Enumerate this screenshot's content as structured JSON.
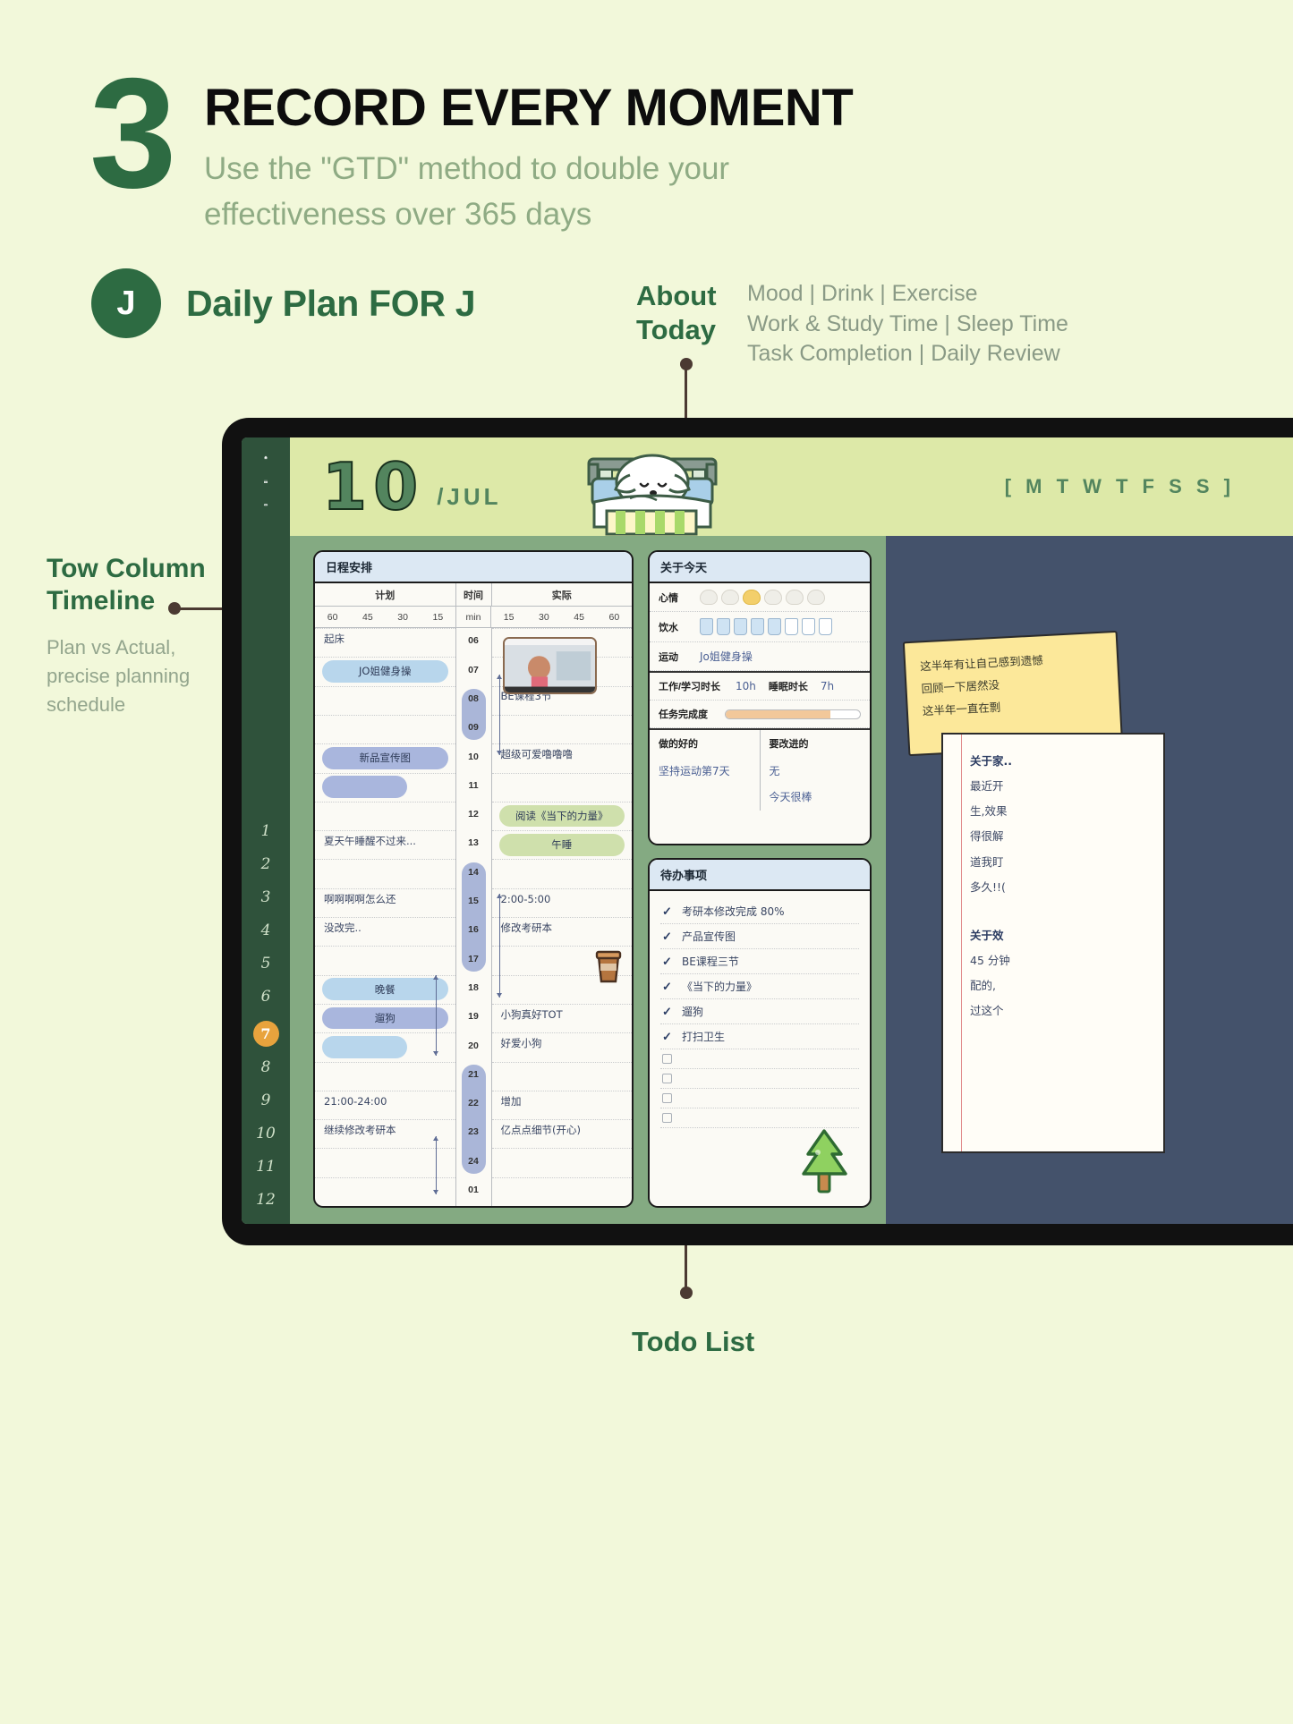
{
  "hero": {
    "step_number": "3",
    "title": "RECORD EVERY MOMENT",
    "subtitle_line1": "Use the \"GTD\" method to double your",
    "subtitle_line2": "effectiveness over 365 days"
  },
  "profile": {
    "avatar_initial": "J",
    "label": "Daily Plan FOR J"
  },
  "about_callout": {
    "label_line1": "About",
    "label_line2": "Today",
    "items_line1": "Mood | Drink | Exercise",
    "items_line2": "Work & Study Time | Sleep Time",
    "items_line3": "Task Completion | Daily Review"
  },
  "left_callout": {
    "title_line1": "Tow Column",
    "title_line2": "Timeline",
    "body_line1": "Plan vs Actual,",
    "body_line2": "precise planning",
    "body_line3": "schedule"
  },
  "todo_callout": {
    "label": "Todo List"
  },
  "tablet": {
    "sidebar": {
      "icons": [
        "home-icon",
        "calendar-icon",
        "more-icon"
      ],
      "months": [
        "1",
        "2",
        "3",
        "4",
        "5",
        "6",
        "7",
        "8",
        "9",
        "10",
        "11",
        "12"
      ],
      "active_month": "7"
    },
    "datebar": {
      "day": "10",
      "month": "/JUL",
      "weekdays": "[ M T W T F S S ]"
    },
    "schedule": {
      "card_title": "日程安排",
      "col_plan": "计划",
      "col_time": "时间",
      "col_actual": "实际",
      "plan_ticks": [
        "60",
        "45",
        "30",
        "15"
      ],
      "min_label": "min",
      "actual_ticks": [
        "15",
        "30",
        "45",
        "60"
      ],
      "hours": [
        "06",
        "07",
        "08",
        "09",
        "10",
        "11",
        "12",
        "13",
        "14",
        "15",
        "16",
        "17",
        "18",
        "19",
        "20",
        "21",
        "22",
        "23",
        "24",
        "01"
      ],
      "highlight_hours": [
        "08",
        "09",
        "14",
        "15",
        "16",
        "17",
        "21",
        "22",
        "23",
        "24"
      ],
      "plan_entries": [
        {
          "hour": "06",
          "text": "起床",
          "style": "plain"
        },
        {
          "hour": "07",
          "text": "JO姐健身操",
          "style": "blue-l"
        },
        {
          "hour": "10",
          "text": "新品宣传图",
          "style": "blue-m"
        },
        {
          "hour": "11",
          "text": "",
          "style": "blue-m"
        },
        {
          "hour": "13",
          "text": "夏天午睡醒不过来...",
          "style": "plain"
        },
        {
          "hour": "15",
          "text": "啊啊啊啊怎么还",
          "style": "plain"
        },
        {
          "hour": "16",
          "text": "没改完..",
          "style": "plain"
        },
        {
          "hour": "18",
          "text": "晚餐",
          "style": "blue-l"
        },
        {
          "hour": "19",
          "text": "遛狗",
          "style": "blue-m"
        },
        {
          "hour": "20",
          "text": "",
          "style": "blue-l"
        },
        {
          "hour": "22",
          "text": "21:00-24:00",
          "style": "plain"
        },
        {
          "hour": "23",
          "text": "继续修改考研本",
          "style": "plain"
        }
      ],
      "actual_entries": [
        {
          "hour": "08",
          "text": "BE课程3节",
          "style": "plain"
        },
        {
          "hour": "10",
          "text": "超级可爱噜噜噜",
          "style": "plain"
        },
        {
          "hour": "12",
          "text": "阅读《当下的力量》",
          "style": "green"
        },
        {
          "hour": "13",
          "text": "午睡",
          "style": "green"
        },
        {
          "hour": "15",
          "text": "2:00-5:00",
          "style": "plain"
        },
        {
          "hour": "16",
          "text": "修改考研本",
          "style": "plain"
        },
        {
          "hour": "19",
          "text": "小狗真好TOT",
          "style": "plain"
        },
        {
          "hour": "20",
          "text": "好爱小狗",
          "style": "plain"
        },
        {
          "hour": "22",
          "text": "增加",
          "style": "plain"
        },
        {
          "hour": "23",
          "text": "亿点点细节(开心)",
          "style": "plain"
        }
      ]
    },
    "about_today": {
      "card_title": "关于今天",
      "mood_label": "心情",
      "mood_count": 6,
      "mood_selected": 2,
      "drink_label": "饮水",
      "drink_total": 8,
      "drink_filled": 5,
      "exercise_label": "运动",
      "exercise_value": "Jo姐健身操",
      "work_label": "工作/学习时长",
      "work_value": "10h",
      "sleep_label": "睡眠时长",
      "sleep_value": "7h",
      "task_label": "任务完成度",
      "task_percent": 78,
      "good_label": "做的好的",
      "good_value": "坚持运动第7天",
      "improve_label": "要改进的",
      "improve_value_1": "无",
      "improve_value_2": "今天很棒"
    },
    "todo": {
      "card_title": "待办事项",
      "done": [
        "考研本修改完成 80%",
        "产品宣传图",
        "BE课程三节",
        "《当下的力量》",
        "遛狗",
        "打扫卫生"
      ],
      "empty_count": 4
    },
    "notes": {
      "sticky_lines": [
        "这半年有让自己感到遗憾",
        "回顾一下居然没",
        "这半年一直在剽"
      ],
      "paper_lines": [
        "关于家..",
        "最近开",
        "生,效果",
        "得很解",
        "道我盯",
        "多久!!(",
        "关于效",
        "45 分钟",
        "配的,",
        "过这个"
      ]
    }
  },
  "colors": {
    "page_bg": "#f2f8da",
    "brand_green": "#2d6b42",
    "muted_green": "#8fab84",
    "tablet_frame": "#111111",
    "tablet_page": "#84aa82",
    "date_banner": "#dde9a8",
    "accent_orange": "#e8a33d"
  }
}
